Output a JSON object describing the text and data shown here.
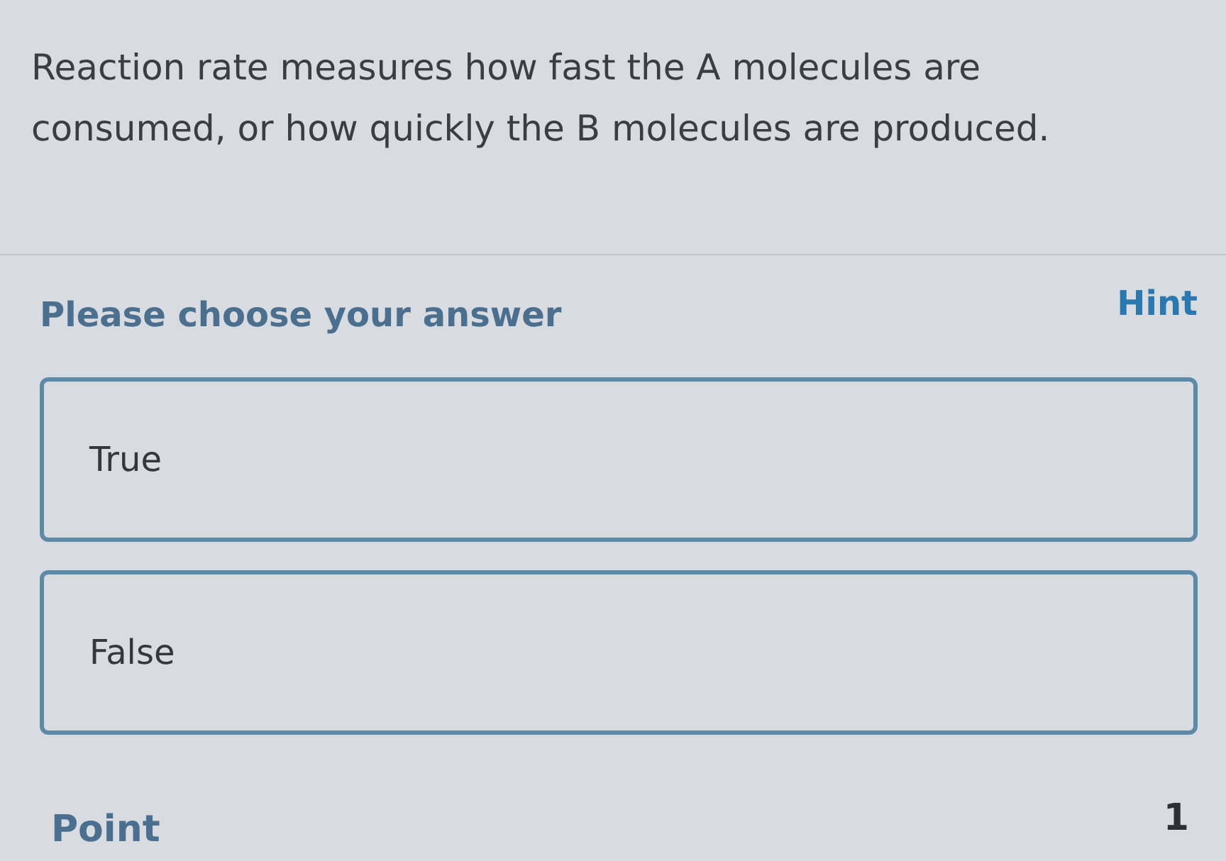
{
  "question": {
    "text": "Reaction rate measures how fast the A molecules are consumed, or how quickly the B molecules are produced."
  },
  "answer_section": {
    "prompt": "Please choose your answer",
    "hint": "Hint"
  },
  "options": [
    {
      "label": "True",
      "selected": false
    },
    {
      "label": "False",
      "selected": false
    }
  ],
  "points": {
    "label": "Point",
    "value": "1"
  }
}
